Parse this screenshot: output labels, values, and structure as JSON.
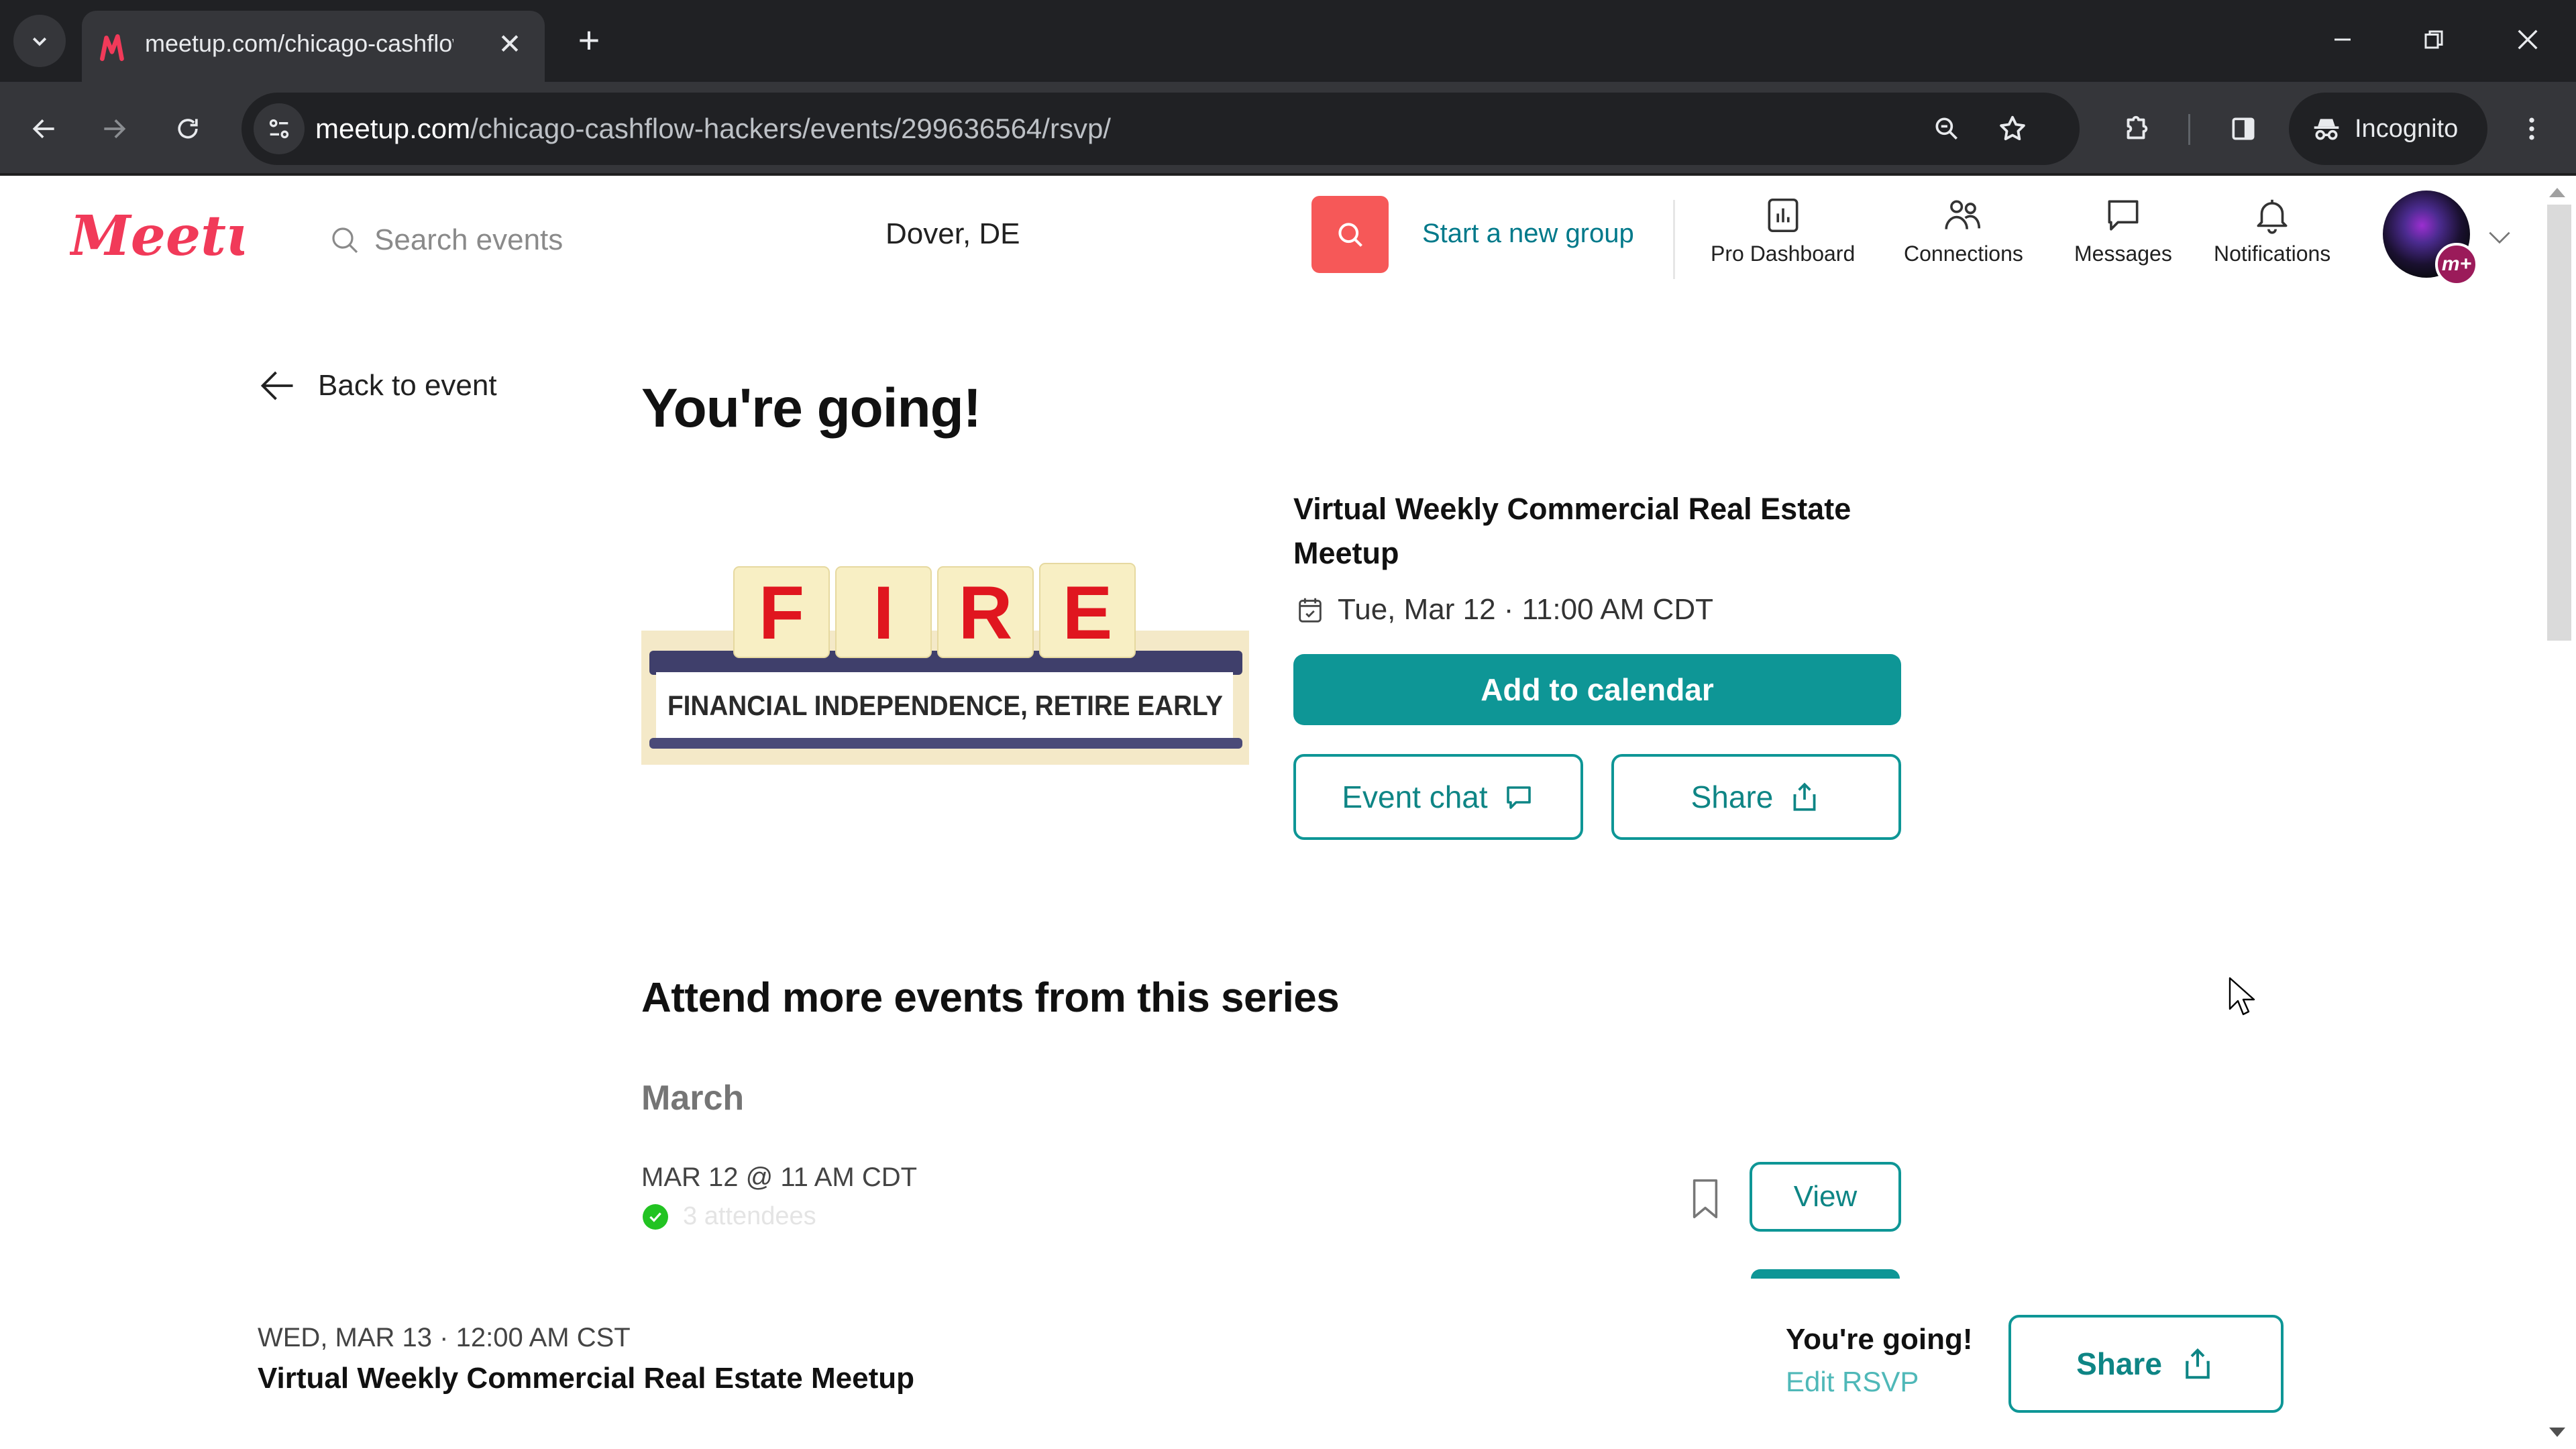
{
  "browser": {
    "tab_title": "meetup.com/chicago-cashflow",
    "url_host": "meetup.com",
    "url_path": "/chicago-cashflow-hackers/events/299636564/rsvp/",
    "incognito_label": "Incognito",
    "icons": [
      "tab-search-icon",
      "meetup-favicon",
      "close-icon",
      "plus-icon",
      "minimize-icon",
      "restore-icon",
      "close-window-icon",
      "back-icon",
      "forward-icon",
      "reload-icon",
      "site-info-icon",
      "zoom-icon",
      "star-icon",
      "extensions-icon",
      "side-panel-icon",
      "incognito-icon",
      "menu-icon"
    ]
  },
  "header": {
    "logo_text": "Meetup",
    "search_placeholder": "Search events",
    "location": "Dover, DE",
    "start_group_label": "Start a new group",
    "nav": [
      {
        "label": "Pro Dashboard",
        "icon": "bar-chart-icon"
      },
      {
        "label": "Connections",
        "icon": "people-icon"
      },
      {
        "label": "Messages",
        "icon": "chat-icon"
      },
      {
        "label": "Notifications",
        "icon": "bell-icon"
      }
    ],
    "avatar_badge": "m+"
  },
  "main": {
    "back_label": "Back to event",
    "title": "You're going!",
    "image": {
      "letters": [
        "F",
        "I",
        "R",
        "E"
      ],
      "caption": "FINANCIAL INDEPENDENCE, RETIRE EARLY"
    },
    "event": {
      "title": "Virtual Weekly Commercial Real Estate Meetup",
      "datetime": "Tue, Mar 12 · 11:00 AM CDT",
      "add_calendar_label": "Add to calendar",
      "event_chat_label": "Event chat",
      "share_label": "Share"
    },
    "series": {
      "heading": "Attend more events from this series",
      "month": "March",
      "items": [
        {
          "date": "MAR 12 @ 11 AM CDT",
          "attendees": "3 attendees",
          "view_label": "View"
        }
      ]
    }
  },
  "sticky": {
    "date": "WED, MAR 13 · 12:00 AM CST",
    "title": "Virtual Weekly Commercial Real Estate Meetup",
    "status": "You're going!",
    "edit_label": "Edit RSVP",
    "share_label": "Share"
  },
  "colors": {
    "brand": "#f13a59",
    "teal": "#0e9696",
    "search_red": "#f65858",
    "check_green": "#22c322"
  }
}
